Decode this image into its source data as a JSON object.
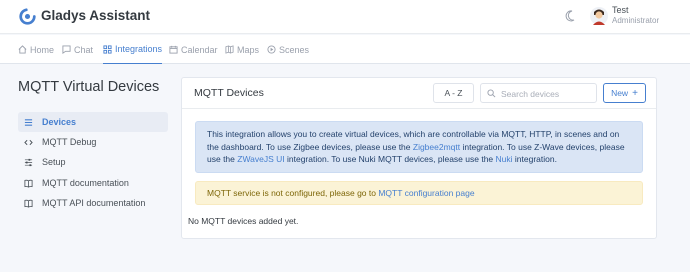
{
  "app": {
    "name": "Gladys Assistant"
  },
  "user": {
    "name": "Test",
    "role": "Administrator"
  },
  "nav": {
    "items": [
      {
        "label": "Home",
        "icon": "home-icon"
      },
      {
        "label": "Chat",
        "icon": "chat-icon"
      },
      {
        "label": "Integrations",
        "icon": "grid-icon",
        "active": true
      },
      {
        "label": "Calendar",
        "icon": "calendar-icon"
      },
      {
        "label": "Maps",
        "icon": "map-icon"
      },
      {
        "label": "Scenes",
        "icon": "play-icon"
      }
    ]
  },
  "sidebar": {
    "title": "MQTT Virtual Devices",
    "items": [
      {
        "label": "Devices",
        "icon": "list-icon",
        "active": true
      },
      {
        "label": "MQTT Debug",
        "icon": "code-icon"
      },
      {
        "label": "Setup",
        "icon": "sliders-icon"
      },
      {
        "label": "MQTT documentation",
        "icon": "book-icon"
      },
      {
        "label": "MQTT API documentation",
        "icon": "book-icon"
      }
    ]
  },
  "main": {
    "title": "MQTT Devices",
    "sort_value": "A - Z",
    "search_placeholder": "Search devices",
    "new_label": "New",
    "info": {
      "p1": "This integration allows you to create virtual devices, which are controllable via MQTT, HTTP, in scenes and on the dashboard. To use Zigbee devices, please use the ",
      "link1": "Zigbee2mqtt",
      "p2": " integration. To use Z-Wave devices, please use the ",
      "link2": "ZWaveJS UI",
      "p3": " integration. To use Nuki MQTT devices, please use the ",
      "link3": "Nuki",
      "p4": " integration."
    },
    "warning": {
      "text": "MQTT service is not configured, please go to ",
      "link": "MQTT configuration page"
    },
    "empty_text": "No MQTT devices added yet."
  },
  "colors": {
    "accent": "#467fcf",
    "info_bg": "#dae5f5",
    "warning_bg": "#fbf3d6",
    "page_bg": "#f5f7fb"
  }
}
